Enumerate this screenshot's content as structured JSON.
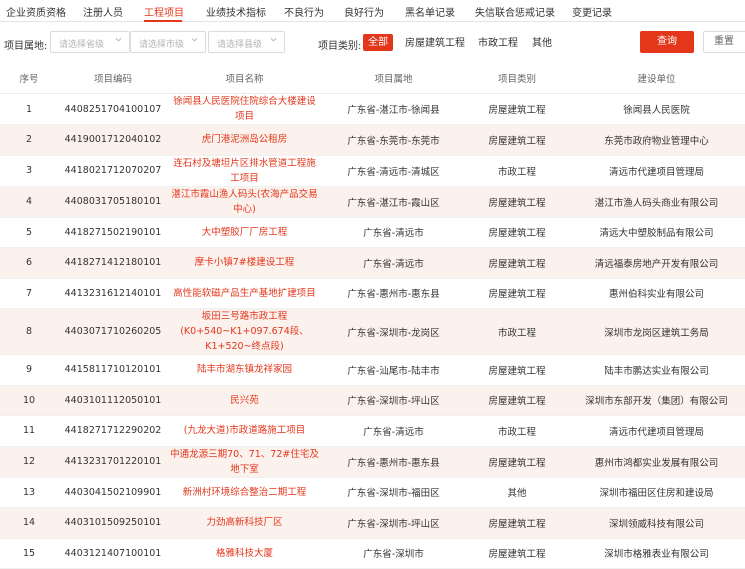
{
  "tabs": [
    {
      "label": "企业资质资格",
      "active": false
    },
    {
      "label": "注册人员",
      "active": false
    },
    {
      "label": "工程项目",
      "active": true
    },
    {
      "label": "业绩技术指标",
      "active": false
    },
    {
      "label": "不良行为",
      "active": false
    },
    {
      "label": "良好行为",
      "active": false
    },
    {
      "label": "黑名单记录",
      "active": false
    },
    {
      "label": "失信联合惩戒记录",
      "active": false
    },
    {
      "label": "变更记录",
      "active": false
    }
  ],
  "filters": {
    "location_label": "项目属地:",
    "province_placeholder": "请选择省级",
    "city_placeholder": "请选择市级",
    "county_placeholder": "请选择县级",
    "category_label": "项目类别:",
    "categories": [
      {
        "label": "全部",
        "active": true
      },
      {
        "label": "房屋建筑工程",
        "active": false
      },
      {
        "label": "市政工程",
        "active": false
      },
      {
        "label": "其他",
        "active": false
      }
    ],
    "query_label": "查询",
    "reset_label": "重置"
  },
  "table": {
    "columns": [
      "序号",
      "项目编码",
      "项目名称",
      "项目属地",
      "项目类别",
      "建设单位"
    ],
    "rows": [
      [
        "1",
        "4408251704100107",
        "徐闻县人民医院住院综合大楼建设项目",
        "广东省-湛江市-徐闻县",
        "房屋建筑工程",
        "徐闻县人民医院"
      ],
      [
        "2",
        "4419001712040102",
        "虎门港泥洲岛公租房",
        "广东省-东莞市-东莞市",
        "房屋建筑工程",
        "东莞市政府物业管理中心"
      ],
      [
        "3",
        "4418021712070207",
        "连石村及塘坦片区排水管道工程施工项目",
        "广东省-清远市-清城区",
        "市政工程",
        "清远市代建项目管理局"
      ],
      [
        "4",
        "4408031705180101",
        "湛江市霞山渔人码头(农海产品交易中心)",
        "广东省-湛江市-霞山区",
        "房屋建筑工程",
        "湛江市渔人码头商业有限公司"
      ],
      [
        "5",
        "4418271502190101",
        "大中塑胶厂厂房工程",
        "广东省-清远市",
        "房屋建筑工程",
        "清远大中塑胶制品有限公司"
      ],
      [
        "6",
        "4418271412180101",
        "摩卡小镇7#楼建设工程",
        "广东省-清远市",
        "房屋建筑工程",
        "清远福泰房地产开发有限公司"
      ],
      [
        "7",
        "4413231612140101",
        "高性能软磁产品生产基地扩建项目",
        "广东省-惠州市-惠东县",
        "房屋建筑工程",
        "惠州伯科实业有限公司"
      ],
      [
        "8",
        "4403071710260205",
        "坂田三号路市政工程(K0+540~K1+097.674段、K1+520~终点段)",
        "广东省-深圳市-龙岗区",
        "市政工程",
        "深圳市龙岗区建筑工务局"
      ],
      [
        "9",
        "4415811710120101",
        "陆丰市湖东镇龙祥家园",
        "广东省-汕尾市-陆丰市",
        "房屋建筑工程",
        "陆丰市鹏达实业有限公司"
      ],
      [
        "10",
        "4403101112050101",
        "民兴苑",
        "广东省-深圳市-坪山区",
        "房屋建筑工程",
        "深圳市东部开发（集团）有限公司"
      ],
      [
        "11",
        "4418271712290202",
        "(九龙大道)市政道路施工项目",
        "广东省-清远市",
        "市政工程",
        "清远市代建项目管理局"
      ],
      [
        "12",
        "4413231701220101",
        "中通龙源三期70、71、72#住宅及地下室",
        "广东省-惠州市-惠东县",
        "房屋建筑工程",
        "惠州市鸿都实业发展有限公司"
      ],
      [
        "13",
        "4403041502109901",
        "新洲村环境综合整治二期工程",
        "广东省-深圳市-福田区",
        "其他",
        "深圳市福田区住房和建设局"
      ],
      [
        "14",
        "4403101509250101",
        "力劲高新科技厂区",
        "广东省-深圳市-坪山区",
        "房屋建筑工程",
        "深圳领威科技有限公司"
      ],
      [
        "15",
        "4403121407100101",
        "格雅科技大厦",
        "广东省-深圳市",
        "房屋建筑工程",
        "深圳市格雅表业有限公司"
      ]
    ]
  }
}
